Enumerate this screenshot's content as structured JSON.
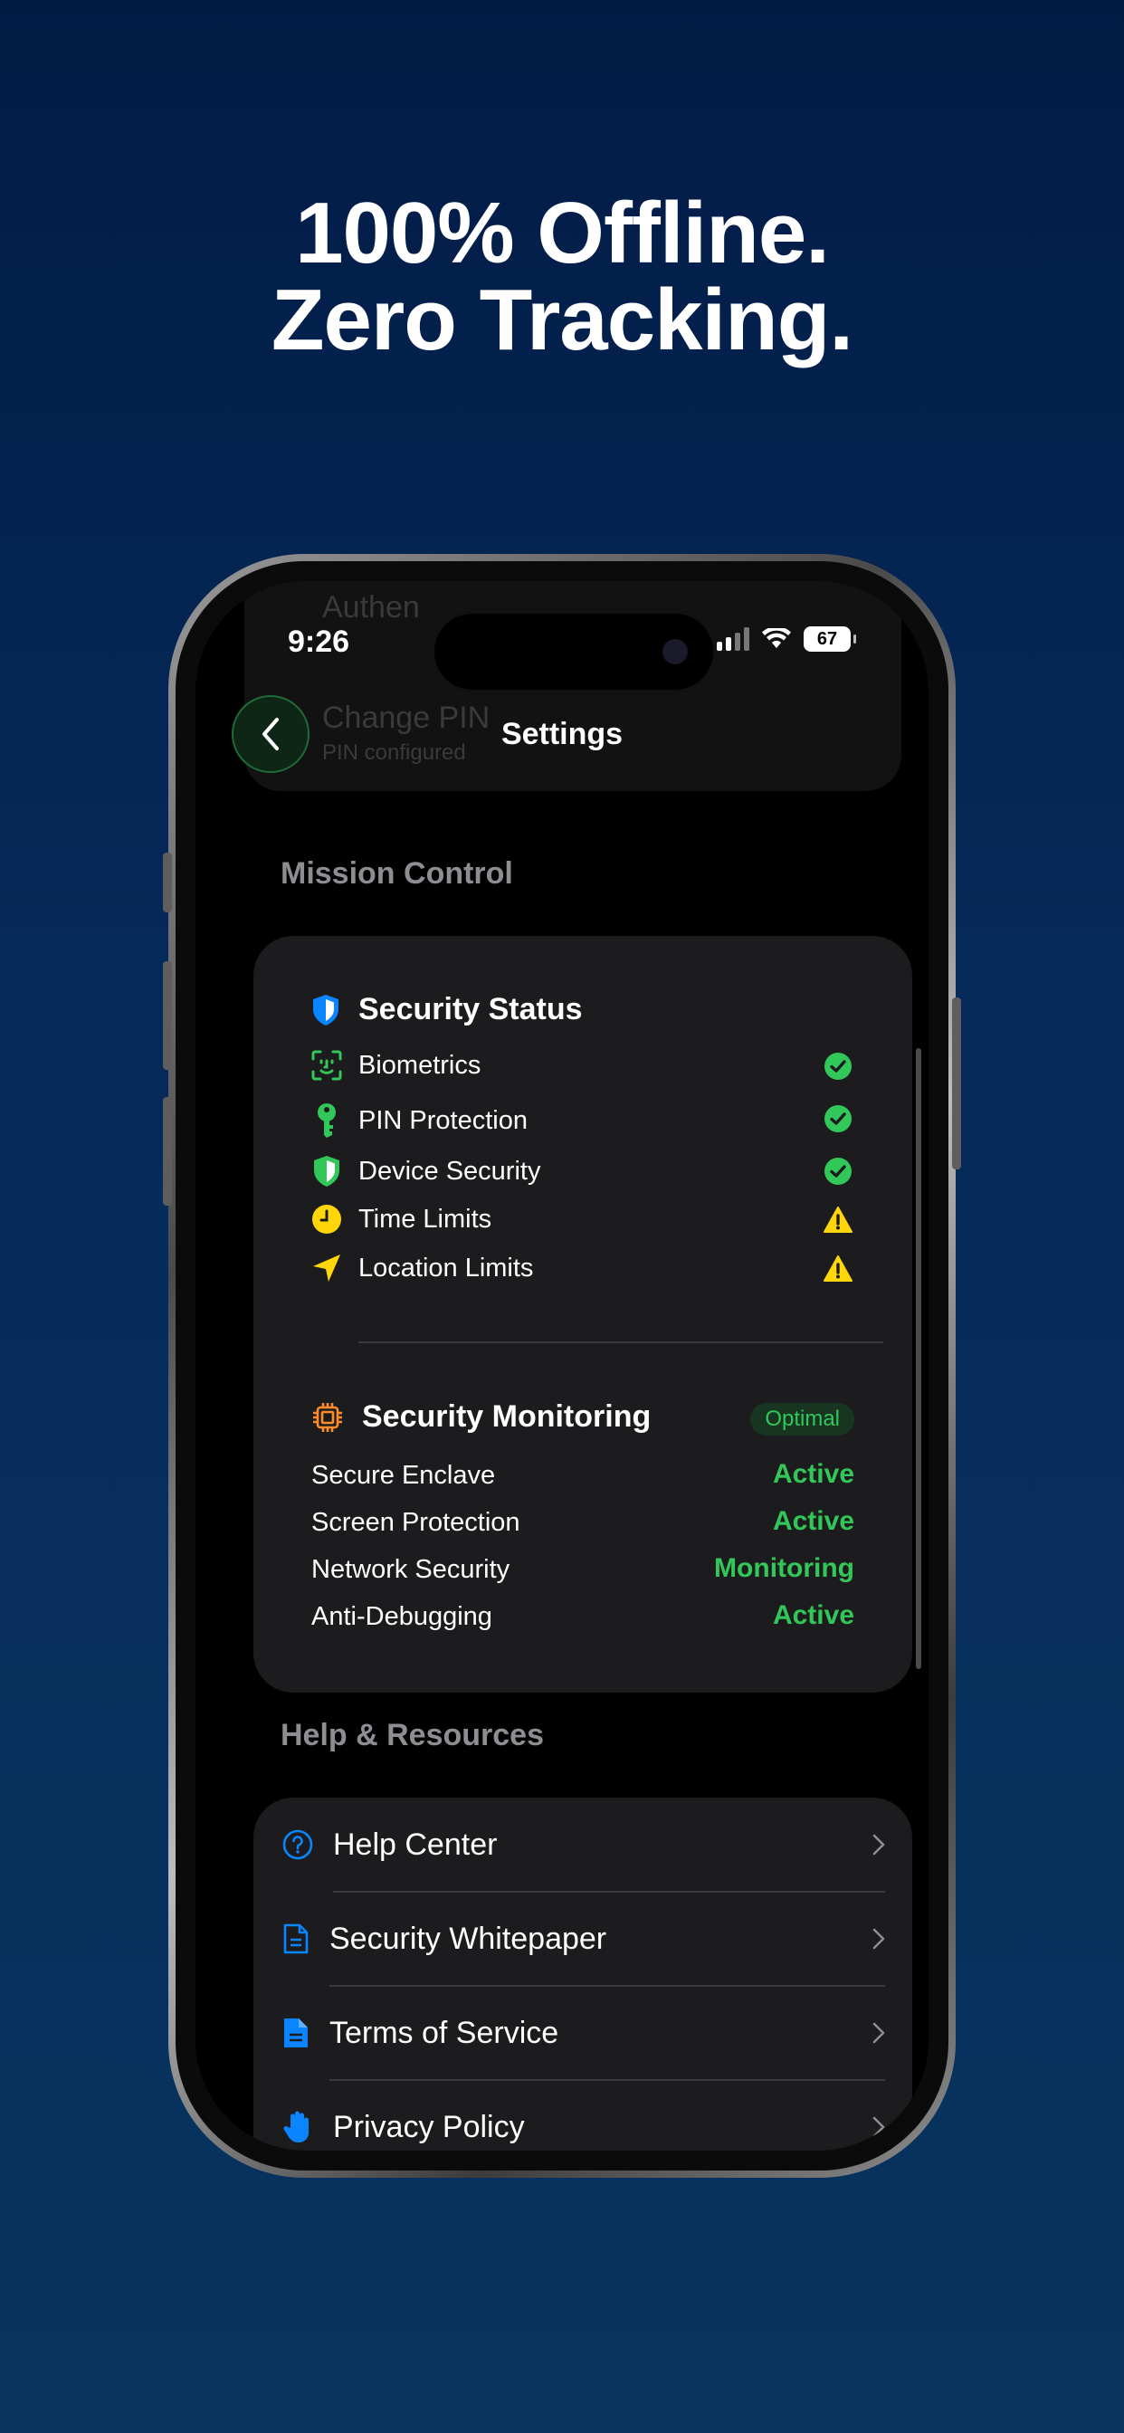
{
  "headline": {
    "line1": "100% Offline.",
    "line2": "Zero Tracking."
  },
  "status_bar": {
    "time": "9:26",
    "battery": "67"
  },
  "nav": {
    "title": "Settings",
    "ghost_item_1": "Authen",
    "ghost_item_2": "Change PIN",
    "ghost_item_2_sub": "PIN configured"
  },
  "mission_control": {
    "section_label": "Mission Control",
    "security_status": {
      "title": "Security Status",
      "items": [
        {
          "label": "Biometrics",
          "state": "ok",
          "icon": "face-id-icon",
          "color": "#32c759"
        },
        {
          "label": "PIN Protection",
          "state": "ok",
          "icon": "key-icon",
          "color": "#32c759"
        },
        {
          "label": "Device Security",
          "state": "ok",
          "icon": "shield-icon",
          "color": "#32c759"
        },
        {
          "label": "Time Limits",
          "state": "warning",
          "icon": "clock-icon",
          "color": "#ffd60a"
        },
        {
          "label": "Location Limits",
          "state": "warning",
          "icon": "location-arrow-icon",
          "color": "#ffd60a"
        }
      ]
    },
    "security_monitoring": {
      "title": "Security Monitoring",
      "badge": "Optimal",
      "items": [
        {
          "label": "Secure Enclave",
          "value": "Active"
        },
        {
          "label": "Screen Protection",
          "value": "Active"
        },
        {
          "label": "Network Security",
          "value": "Monitoring"
        },
        {
          "label": "Anti-Debugging",
          "value": "Active"
        }
      ]
    }
  },
  "help": {
    "section_label": "Help & Resources",
    "items": [
      {
        "label": "Help Center",
        "icon": "question-circle-icon"
      },
      {
        "label": "Security Whitepaper",
        "icon": "document-icon"
      },
      {
        "label": "Terms of Service",
        "icon": "document-filled-icon"
      },
      {
        "label": "Privacy Policy",
        "icon": "hand-icon"
      }
    ]
  },
  "colors": {
    "accent_green": "#32c759",
    "warning": "#ffd60a",
    "blue": "#0a84ff",
    "card": "#1c1c1e",
    "orange": "#ff8c2a"
  }
}
